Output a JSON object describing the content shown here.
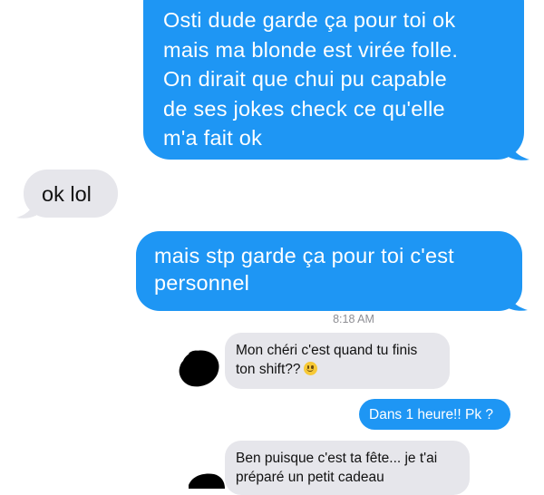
{
  "conversation": {
    "messages": [
      {
        "sender": "me",
        "text": "Osti dude garde ça pour toi ok\nmais ma blonde est virée folle.\nOn dirait que chui pu capable\nde ses jokes check ce qu'elle\nm'a fait ok"
      },
      {
        "sender": "them",
        "text": "ok lol"
      },
      {
        "sender": "me",
        "text": "mais stp garde ça pour toi c'est\npersonnel"
      }
    ],
    "screenshot_timestamp": "8:18 AM",
    "embedded": [
      {
        "sender": "them",
        "text": "Mon chéri c'est quand tu finis\nton shift??",
        "emoji": "smiling-face-emoji"
      },
      {
        "sender": "me",
        "text": "Dans 1 heure!! Pk ?"
      },
      {
        "sender": "them",
        "text": "Ben puisque c'est ta fête... je t'ai\npréparé un petit cadeau"
      }
    ]
  },
  "colors": {
    "sent_bubble": "#1e96f4",
    "received_bubble": "#e6e6eb",
    "timestamp_text": "#8e8e93"
  }
}
